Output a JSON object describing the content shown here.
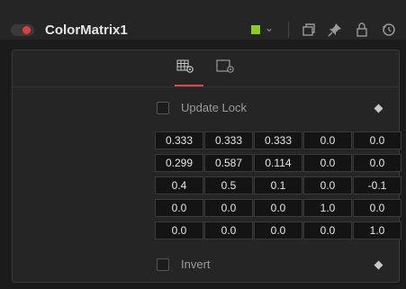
{
  "header": {
    "title": "ColorMatrix1",
    "toggle_color": "#e53b3b",
    "swatch_color": "#8ccc1c",
    "icons": [
      "chevron-down-icon",
      "versions-icon",
      "pin-icon",
      "lock-icon",
      "reset-icon"
    ]
  },
  "tabs": [
    {
      "icon": "grid-settings-icon",
      "active": true
    },
    {
      "icon": "frame-settings-icon",
      "active": false
    }
  ],
  "update_lock": {
    "label": "Update Lock",
    "checked": false
  },
  "matrix": [
    [
      "0.333",
      "0.333",
      "0.333",
      "0.0",
      "0.0"
    ],
    [
      "0.299",
      "0.587",
      "0.114",
      "0.0",
      "0.0"
    ],
    [
      "0.4",
      "0.5",
      "0.1",
      "0.0",
      "-0.1"
    ],
    [
      "0.0",
      "0.0",
      "0.0",
      "1.0",
      "0.0"
    ],
    [
      "0.0",
      "0.0",
      "0.0",
      "0.0",
      "1.0"
    ]
  ],
  "invert": {
    "label": "Invert",
    "checked": false
  }
}
